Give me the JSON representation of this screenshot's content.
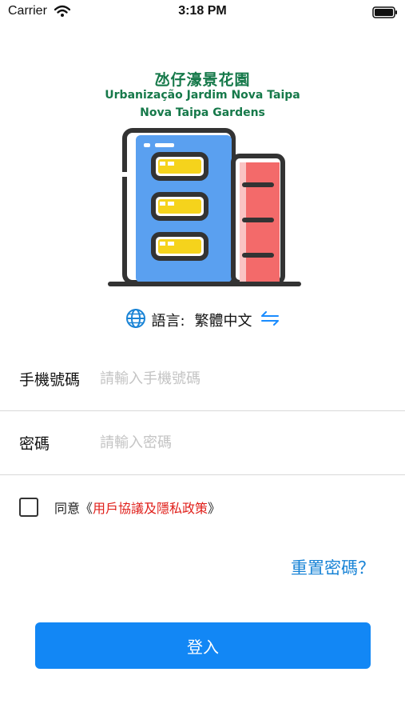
{
  "status_bar": {
    "carrier": "Carrier",
    "time": "3:18 PM",
    "icons": [
      "wifi-icon",
      "battery-icon"
    ]
  },
  "header": {
    "title_zh": "氹仔濠景花園",
    "title_pt": "Urbanização Jardim Nova Taipa",
    "title_en": "Nova Taipa Gardens",
    "brand_color": "#16794a"
  },
  "language": {
    "label": "語言:",
    "value": "繁體中文",
    "icons": [
      "globe-icon",
      "swap-icon"
    ]
  },
  "form": {
    "phone": {
      "label": "手機號碼",
      "placeholder": "請輸入手機號碼",
      "value": ""
    },
    "password": {
      "label": "密碼",
      "placeholder": "請輸入密碼",
      "value": ""
    },
    "agree": {
      "prefix": "同意《",
      "policy": "用戶協議及隱私政策",
      "suffix": "》",
      "checked": false
    },
    "reset_password": "重置密碼？",
    "login_button": "登入"
  },
  "colors": {
    "accent": "#1287f5",
    "link": "#1a84d6",
    "policy_red": "#e0201b",
    "building_blue": "#5aa0f0",
    "building_red": "#f36a6a",
    "window_yellow": "#f5d31c"
  }
}
